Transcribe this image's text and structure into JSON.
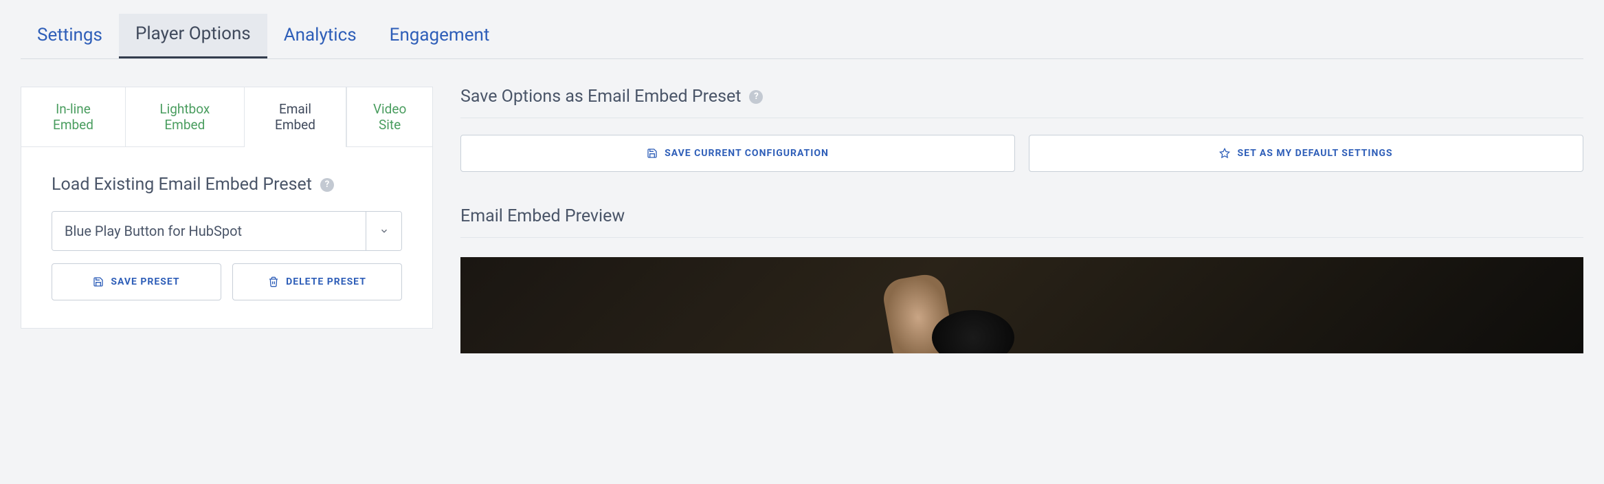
{
  "mainTabs": {
    "settings": "Settings",
    "playerOptions": "Player Options",
    "analytics": "Analytics",
    "engagement": "Engagement"
  },
  "subTabs": {
    "inline": "In-line Embed",
    "lightbox": "Lightbox Embed",
    "email": "Email Embed",
    "videoSite": "Video Site"
  },
  "leftPanel": {
    "heading": "Load Existing Email Embed Preset",
    "selectedPreset": "Blue Play Button for HubSpot",
    "savePreset": "SAVE PRESET",
    "deletePreset": "DELETE PRESET"
  },
  "rightPanel": {
    "saveOptionsHeading": "Save Options as Email Embed Preset",
    "saveConfig": "SAVE CURRENT CONFIGURATION",
    "setDefault": "SET AS MY DEFAULT SETTINGS",
    "previewHeading": "Email Embed Preview"
  }
}
